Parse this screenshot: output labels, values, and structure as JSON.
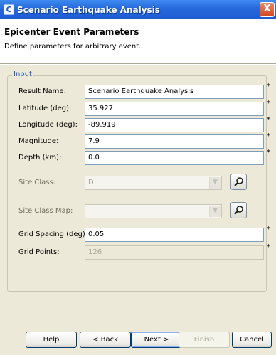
{
  "window": {
    "title": "Scenario Earthquake Analysis",
    "close_label": "X"
  },
  "header": {
    "title": "Epicenter Event Parameters",
    "subtitle": "Define parameters for arbitrary event."
  },
  "group": {
    "legend": "Input"
  },
  "fields": [
    {
      "label": "Result Name:",
      "value": "Scenario Earthquake Analysis",
      "required": "*"
    },
    {
      "label": "Latitude (deg):",
      "value": "35.927",
      "required": "*"
    },
    {
      "label": "Longitude (deg):",
      "value": "-89.919",
      "required": "*"
    },
    {
      "label": "Magnitude:",
      "value": "7.9",
      "required": "*"
    },
    {
      "label": "Depth (km):",
      "value": "0.0",
      "required": "*"
    }
  ],
  "site_class": {
    "label": "Site Class:",
    "value": "D",
    "icon": "search-icon"
  },
  "site_class_map": {
    "label": "Site Class Map:",
    "value": "",
    "icon": "search-icon"
  },
  "grid_spacing": {
    "label": "Grid Spacing (deg):",
    "value": "0.05",
    "required": "*"
  },
  "grid_points": {
    "label": "Grid Points:",
    "value": "126",
    "required": "*"
  },
  "buttons": {
    "help": "Help",
    "back": "< Back",
    "next": "Next >",
    "finish": "Finish",
    "cancel": "Cancel"
  }
}
